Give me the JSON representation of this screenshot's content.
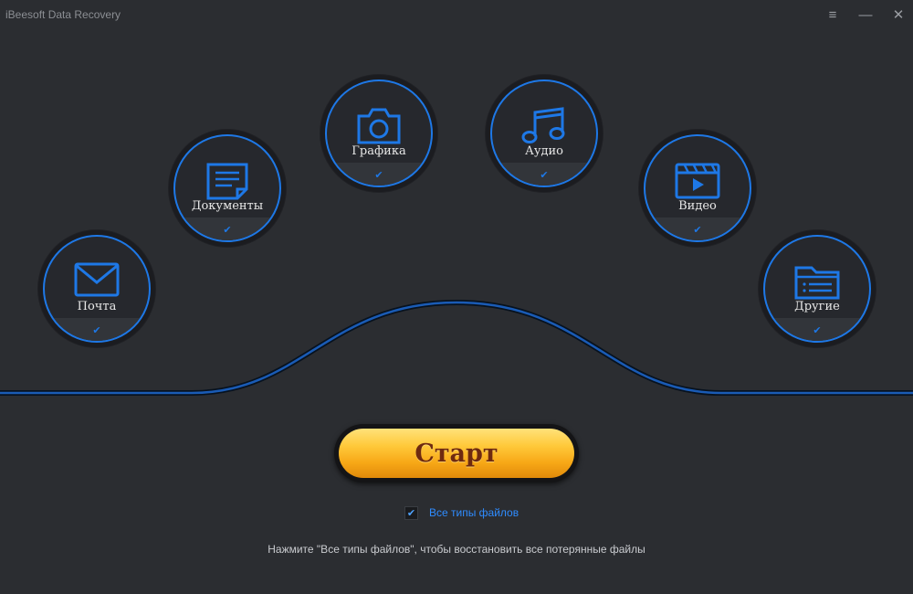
{
  "titlebar": {
    "app_title": "iBeesoft Data Recovery",
    "buttons": [
      {
        "name": "menu-icon",
        "glyph": "≡"
      },
      {
        "name": "minimize-icon",
        "glyph": "—"
      },
      {
        "name": "close-icon",
        "glyph": "✕"
      }
    ]
  },
  "categories": [
    {
      "id": "mail",
      "label": "Почта",
      "icon": "envelope-icon",
      "checked": true
    },
    {
      "id": "documents",
      "label": "Документы",
      "icon": "document-icon",
      "checked": true
    },
    {
      "id": "graphics",
      "label": "Графика",
      "icon": "camera-icon",
      "checked": true
    },
    {
      "id": "audio",
      "label": "Аудио",
      "icon": "music-note-icon",
      "checked": true
    },
    {
      "id": "video",
      "label": "Видео",
      "icon": "video-clapper-icon",
      "checked": true
    },
    {
      "id": "other",
      "label": "Другие",
      "icon": "folder-icon",
      "checked": true
    }
  ],
  "start_button": {
    "label": "Старт"
  },
  "all_types": {
    "label": "Все типы файлов",
    "checked": true
  },
  "hint": "Нажмите \"Все типы файлов\", чтобы восстановить все потерянные файлы",
  "colors": {
    "accent": "#1e78e6",
    "background": "#2b2d31",
    "start_gold": "#ffc93a",
    "start_text": "#6e2a10"
  }
}
